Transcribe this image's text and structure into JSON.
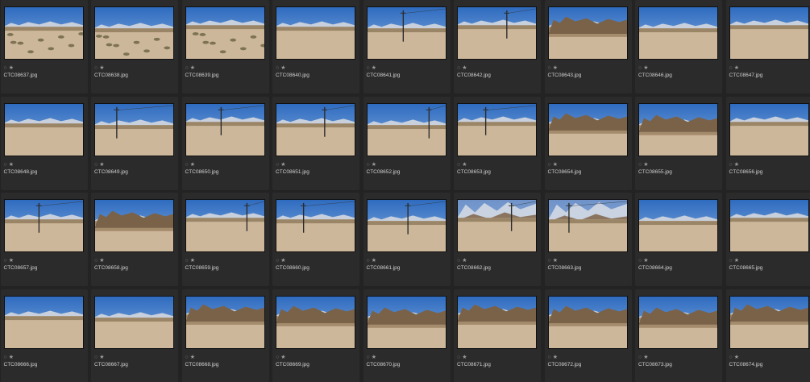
{
  "browser": {
    "rating_marks": {
      "flag": "○",
      "star": "★"
    },
    "thumbnails": [
      {
        "file": "CTC08637.jpg",
        "scene": "brush"
      },
      {
        "file": "CTC08638.jpg",
        "scene": "brush"
      },
      {
        "file": "CTC08639.jpg",
        "scene": "brush"
      },
      {
        "file": "CTC08640.jpg",
        "scene": "flat"
      },
      {
        "file": "CTC08641.jpg",
        "scene": "pole"
      },
      {
        "file": "CTC08642.jpg",
        "scene": "pole"
      },
      {
        "file": "CTC08643.jpg",
        "scene": "rocks"
      },
      {
        "file": "CTC08646.jpg",
        "scene": "flat"
      },
      {
        "file": "CTC08647.jpg",
        "scene": "flat"
      },
      {
        "file": "CTC08648.jpg",
        "scene": "flat"
      },
      {
        "file": "CTC08649.jpg",
        "scene": "pole"
      },
      {
        "file": "CTC08650.jpg",
        "scene": "pole"
      },
      {
        "file": "CTC08651.jpg",
        "scene": "pole"
      },
      {
        "file": "CTC08652.jpg",
        "scene": "pole"
      },
      {
        "file": "CTC08653.jpg",
        "scene": "pole"
      },
      {
        "file": "CTC08654.jpg",
        "scene": "rocks"
      },
      {
        "file": "CTC08655.jpg",
        "scene": "rocks"
      },
      {
        "file": "CTC08656.jpg",
        "scene": "flat"
      },
      {
        "file": "CTC08657.jpg",
        "scene": "pole"
      },
      {
        "file": "CTC08658.jpg",
        "scene": "rocks"
      },
      {
        "file": "CTC08659.jpg",
        "scene": "pole"
      },
      {
        "file": "CTC08660.jpg",
        "scene": "pole"
      },
      {
        "file": "CTC08661.jpg",
        "scene": "pole"
      },
      {
        "file": "CTC08662.jpg",
        "scene": "mountain"
      },
      {
        "file": "CTC08663.jpg",
        "scene": "mountain"
      },
      {
        "file": "CTC08664.jpg",
        "scene": "flat"
      },
      {
        "file": "CTC08665.jpg",
        "scene": "flat"
      },
      {
        "file": "CTC08666.jpg",
        "scene": "flat"
      },
      {
        "file": "CTC08667.jpg",
        "scene": "flat"
      },
      {
        "file": "CTC08668.jpg",
        "scene": "rocks"
      },
      {
        "file": "CTC08669.jpg",
        "scene": "rocks"
      },
      {
        "file": "CTC08670.jpg",
        "scene": "rocks"
      },
      {
        "file": "CTC08671.jpg",
        "scene": "rocks"
      },
      {
        "file": "CTC08672.jpg",
        "scene": "rocks"
      },
      {
        "file": "CTC08673.jpg",
        "scene": "rocks"
      },
      {
        "file": "CTC08674.jpg",
        "scene": "rocks"
      }
    ]
  }
}
